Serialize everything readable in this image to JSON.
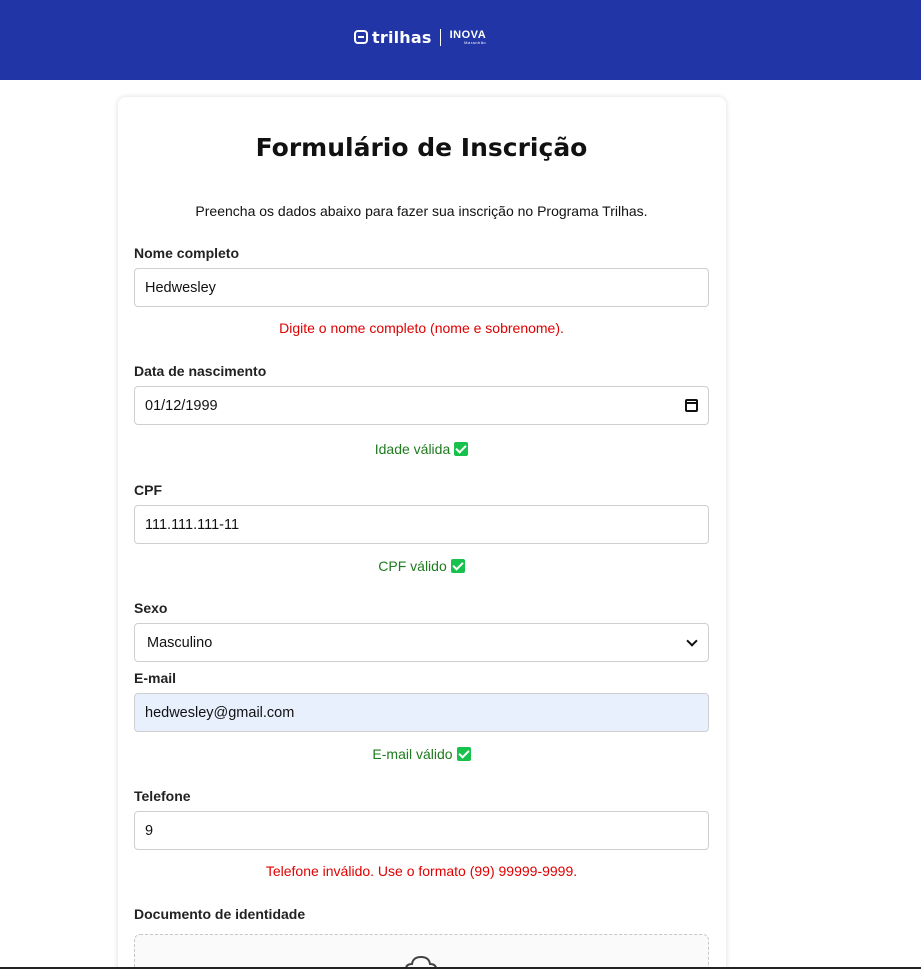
{
  "header": {
    "logo_text": "trilhas",
    "partner_main": "INOVA",
    "partner_sub": "Maranhão",
    "color": "#2135a6"
  },
  "form": {
    "title": "Formulário de Inscrição",
    "intro": "Preencha os dados abaixo para fazer sua inscrição no Programa Trilhas.",
    "nome": {
      "label": "Nome completo",
      "value": "Hedwesley",
      "message": "Digite o nome completo (nome e sobrenome).",
      "status": "error"
    },
    "nascimento": {
      "label": "Data de nascimento",
      "value": "01/12/1999",
      "message": "Idade válida",
      "status": "valid"
    },
    "cpf": {
      "label": "CPF",
      "value": "111.111.111-11",
      "message": "CPF válido",
      "status": "valid"
    },
    "sexo": {
      "label": "Sexo",
      "selected": "Masculino"
    },
    "email": {
      "label": "E-mail",
      "value": "hedwesley@gmail.com",
      "message": "E-mail válido",
      "status": "valid"
    },
    "telefone": {
      "label": "Telefone",
      "value": "9",
      "message": "Telefone inválido. Use o formato (99) 99999-9999.",
      "status": "error"
    },
    "documento": {
      "label": "Documento de identidade",
      "icon": "upload-cloud-icon"
    }
  },
  "colors": {
    "error": "#e00000",
    "valid": "#1e7b1e",
    "check": "#16c24c",
    "autofill": "#e8f0fe"
  }
}
